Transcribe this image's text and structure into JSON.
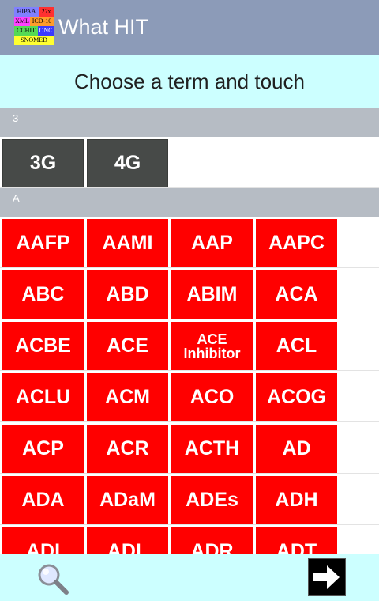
{
  "app": {
    "title": "What HIT",
    "logo_labels": [
      "HIPAA",
      "27x",
      "XML",
      "ICD-10",
      "CCHIT",
      "ONC",
      "SNOMED"
    ]
  },
  "banner": {
    "text": "Choose a term and touch"
  },
  "sections": [
    {
      "header": "3",
      "tiles": [
        [
          "3G",
          "4G"
        ]
      ]
    },
    {
      "header": "A",
      "tiles": [
        [
          "AAFP",
          "AAMI",
          "AAP",
          "AAPC"
        ],
        [
          "ABC",
          "ABD",
          "ABIM",
          "ACA"
        ],
        [
          "ACBE",
          "ACE",
          "ACE Inhibitor",
          "ACL"
        ],
        [
          "ACLU",
          "ACM",
          "ACO",
          "ACOG"
        ],
        [
          "ACP",
          "ACR",
          "ACTH",
          "AD"
        ],
        [
          "ADA",
          "ADaM",
          "ADEs",
          "ADH"
        ],
        [
          "ADI",
          "ADL",
          "ADR",
          "ADT"
        ]
      ]
    }
  ],
  "colors": {
    "app_bar": "#8c9bb8",
    "banner": "#ccffff",
    "section_header": "#b6bcc4",
    "tile_red": "#ff0000",
    "tile_dark": "#474a48",
    "bottom_bar": "#ccffff"
  },
  "icons": {
    "search": "magnifier-icon",
    "next": "arrow-right-icon"
  }
}
